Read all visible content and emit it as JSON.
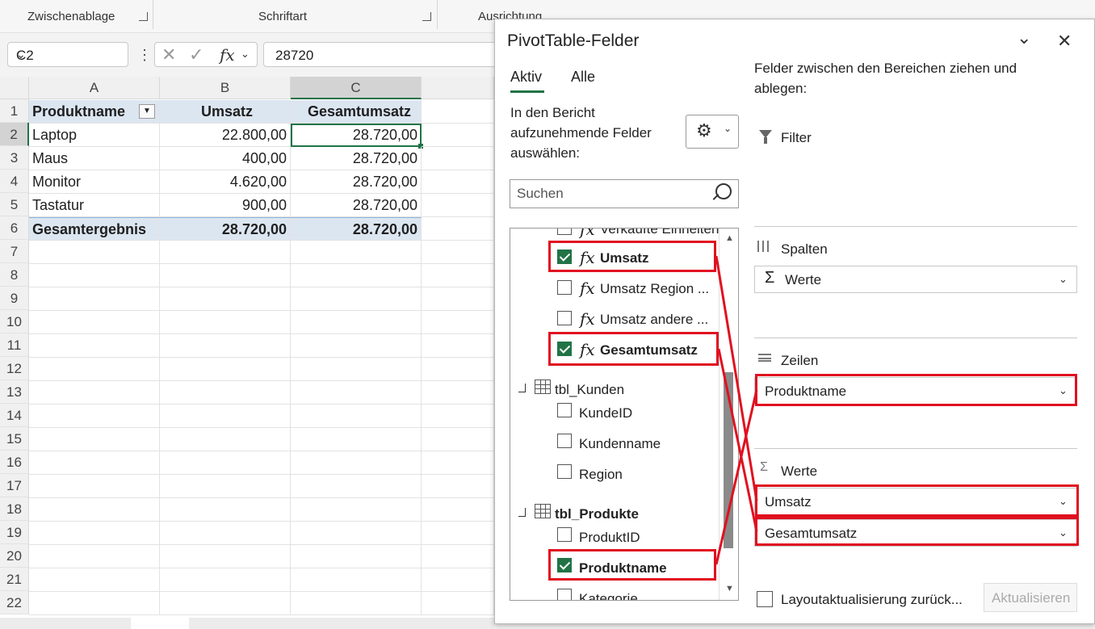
{
  "ribbon": {
    "groups": [
      "Zwischenablage",
      "Schriftart",
      "Ausrichtung"
    ]
  },
  "formula_bar": {
    "name_box": "C2",
    "fx_label": "fx",
    "value": "28720"
  },
  "sheet": {
    "columns": [
      "A",
      "B",
      "C"
    ],
    "rows": [
      "1",
      "2",
      "3",
      "4",
      "5",
      "6",
      "7",
      "8",
      "9",
      "10",
      "11",
      "12",
      "13",
      "14",
      "15",
      "16",
      "17",
      "18",
      "19",
      "20",
      "21",
      "22"
    ],
    "header": [
      "Produktname",
      "Umsatz",
      "Gesamtumsatz"
    ],
    "data": [
      [
        "Laptop",
        "22.800,00",
        "28.720,00"
      ],
      [
        "Maus",
        "400,00",
        "28.720,00"
      ],
      [
        "Monitor",
        "4.620,00",
        "28.720,00"
      ],
      [
        "Tastatur",
        "900,00",
        "28.720,00"
      ]
    ],
    "total": [
      "Gesamtergebnis",
      "28.720,00",
      "28.720,00"
    ]
  },
  "pane": {
    "title": "PivotTable-Felder",
    "tabs": [
      "Aktiv",
      "Alle"
    ],
    "choose_text": [
      "In den Bericht",
      "aufzunehmende Felder",
      "auswählen:"
    ],
    "search_placeholder": "Suchen",
    "drag_text": [
      "Felder zwischen den Bereichen ziehen und",
      "ablegen:"
    ],
    "fields": {
      "cut_top": "Verkaufte Einheiten",
      "umsatz": "Umsatz",
      "umsatz_region": "Umsatz Region ...",
      "umsatz_andere": "Umsatz andere ...",
      "gesamtumsatz": "Gesamtumsatz",
      "tbl_kunden": "tbl_Kunden",
      "kundeid": "KundeID",
      "kundenname": "Kundenname",
      "region": "Region",
      "tbl_produkte": "tbl_Produkte",
      "produktid": "ProduktID",
      "produktname": "Produktname",
      "kategorie": "Kategorie"
    },
    "areas": {
      "filter": "Filter",
      "spalten": "Spalten",
      "spalten_item": "Werte",
      "zeilen": "Zeilen",
      "zeilen_item": "Produktname",
      "werte": "Werte",
      "werte_items": [
        "Umsatz",
        "Gesamtumsatz"
      ]
    },
    "defer_label": "Layoutaktualisierung zurück...",
    "update_button": "Aktualisieren"
  },
  "colors": {
    "highlight": "#e01020",
    "check": "#217346",
    "header_fill": "#dce6f1"
  }
}
